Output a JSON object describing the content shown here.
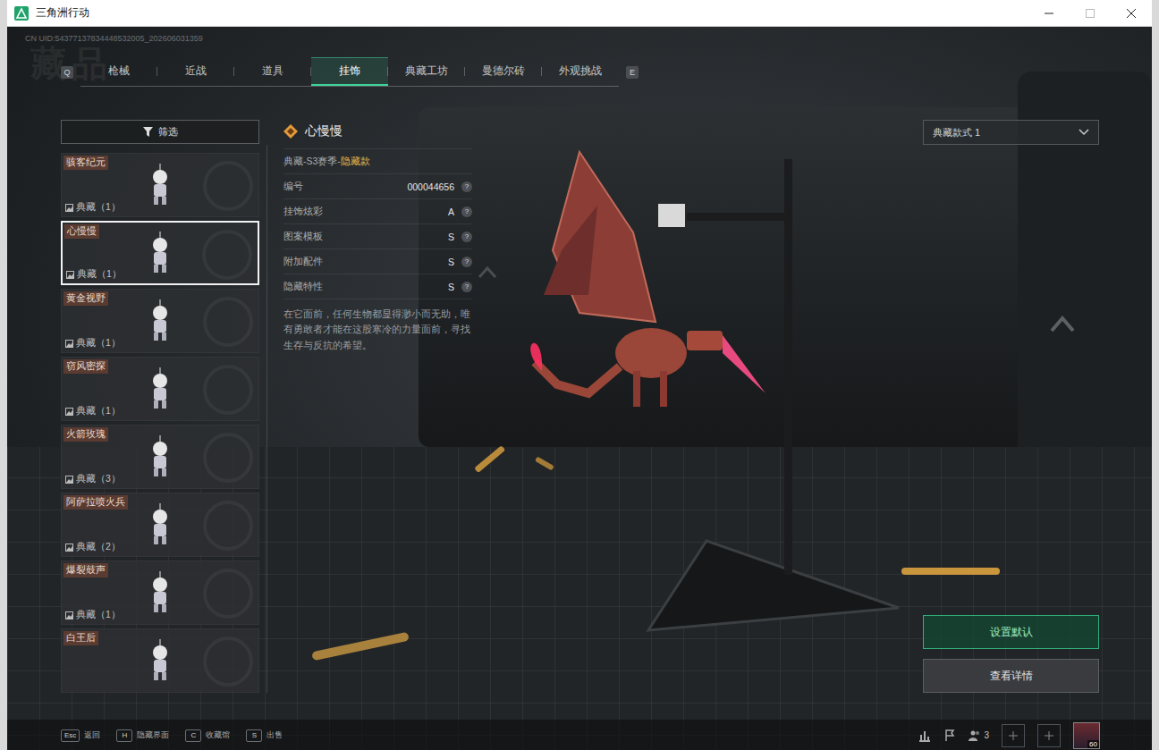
{
  "window": {
    "title": "三角洲行动",
    "uid": "CN UID:54377137834448532005_202606031359"
  },
  "watermark": "藏品",
  "tabs": {
    "prev_key": "Q",
    "next_key": "E",
    "items": [
      {
        "label": "枪械",
        "selected": false
      },
      {
        "label": "近战",
        "selected": false
      },
      {
        "label": "道具",
        "selected": false
      },
      {
        "label": "挂饰",
        "selected": true
      },
      {
        "label": "典藏工坊",
        "selected": false
      },
      {
        "label": "曼德尔砖",
        "selected": false
      },
      {
        "label": "外观挑战",
        "selected": false
      }
    ]
  },
  "filter": {
    "label": "筛选"
  },
  "items": [
    {
      "name": "骇客纪元",
      "tag": "典藏（1）",
      "selected": false
    },
    {
      "name": "心慢慢",
      "tag": "典藏（1）",
      "selected": true
    },
    {
      "name": "黄金视野",
      "tag": "典藏（1）",
      "selected": false
    },
    {
      "name": "窃风密探",
      "tag": "典藏（1）",
      "selected": false
    },
    {
      "name": "火箭玫瑰",
      "tag": "典藏（3）",
      "selected": false
    },
    {
      "name": "阿萨拉喷火兵",
      "tag": "典藏（2）",
      "selected": false
    },
    {
      "name": "爆裂鼓声",
      "tag": "典藏（1）",
      "selected": false
    },
    {
      "name": "白王后",
      "tag": "",
      "selected": false
    }
  ],
  "detail": {
    "name": "心慢慢",
    "category": "典藏-S3赛季-",
    "rarity": "隐藏款",
    "attributes": [
      {
        "label": "编号",
        "value": "000044656",
        "help": "?"
      },
      {
        "label": "挂饰炫彩",
        "value": "A",
        "help": "?"
      },
      {
        "label": "图案模板",
        "value": "S",
        "help": "?"
      },
      {
        "label": "附加配件",
        "value": "S",
        "help": "?"
      },
      {
        "label": "隐藏特性",
        "value": "S",
        "help": "?"
      }
    ],
    "description": "在它面前，任何生物都显得渺小而无助，唯有勇敢者才能在这股寒冷的力量面前，寻找生存与反抗的希望。"
  },
  "style_select": {
    "label": "典藏款式 1"
  },
  "actions": [
    {
      "label": "设置默认",
      "primary": true
    },
    {
      "label": "查看详情",
      "primary": false
    }
  ],
  "hints": [
    {
      "key": "Esc",
      "label": "返回"
    },
    {
      "key": "H",
      "label": "隐藏界面"
    },
    {
      "key": "C",
      "label": "收藏馆"
    },
    {
      "key": "S",
      "label": "出售"
    }
  ],
  "bottom_right": {
    "friends": "3",
    "level": "60"
  }
}
